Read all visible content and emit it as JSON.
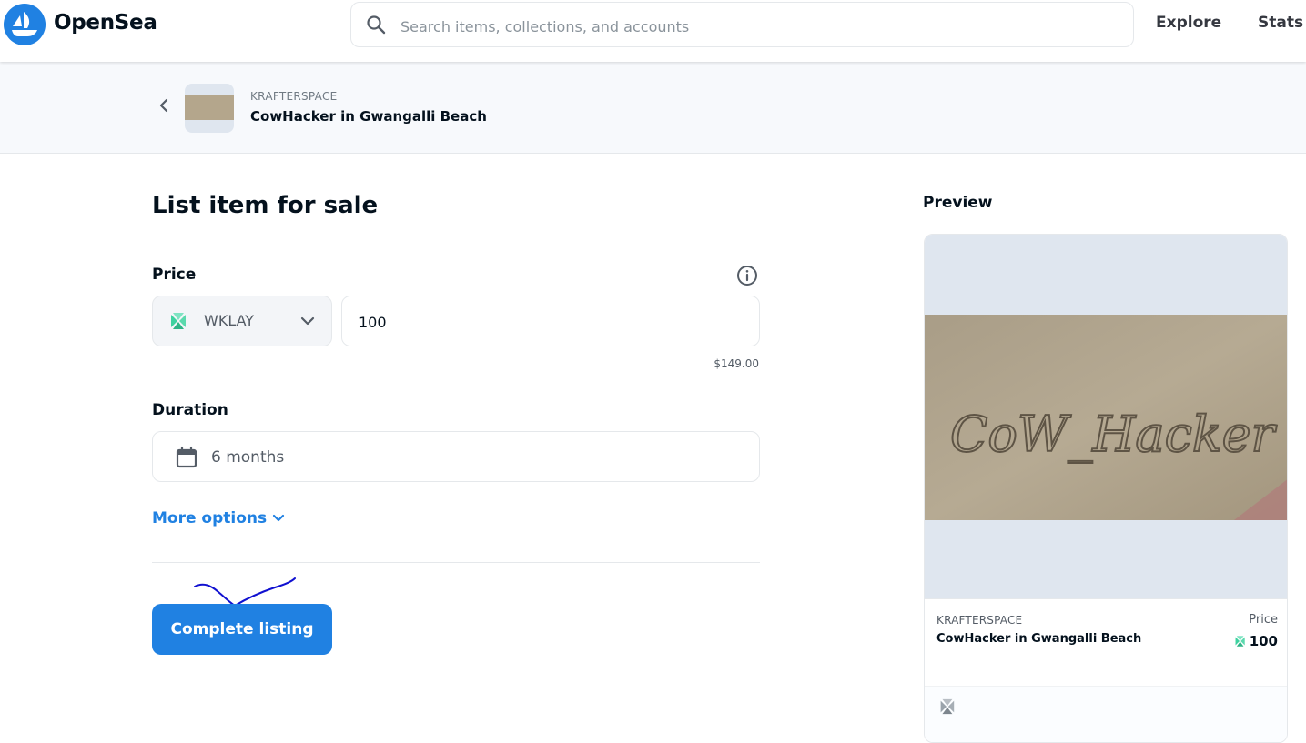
{
  "header": {
    "brand": "OpenSea",
    "search_placeholder": "Search items, collections, and accounts",
    "nav": {
      "explore": "Explore",
      "stats": "Stats"
    }
  },
  "item_header": {
    "collection": "KRAFTERSPACE",
    "name": "CowHacker in Gwangalli Beach"
  },
  "form": {
    "title": "List item for sale",
    "price_label": "Price",
    "currency": "WKLAY",
    "amount": "100",
    "usd_value": "$149.00",
    "duration_label": "Duration",
    "duration_value": "6 months",
    "more_options": "More options",
    "submit": "Complete listing"
  },
  "preview": {
    "title": "Preview",
    "image_text": "CoW_Hacker",
    "collection": "KRAFTERSPACE",
    "name": "CowHacker in Gwangalli Beach",
    "price_label": "Price",
    "price": "100"
  },
  "colors": {
    "accent": "#2081e2",
    "text": "#04111d",
    "muted": "#707a83",
    "klay": "#3ed2a0",
    "annotation": "#1010d0"
  }
}
